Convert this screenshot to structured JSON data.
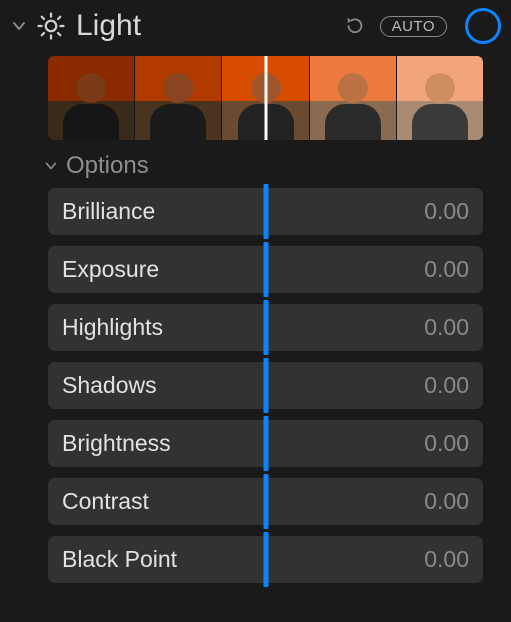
{
  "header": {
    "title": "Light",
    "auto_label": "AUTO"
  },
  "options": {
    "title": "Options"
  },
  "sliders": [
    {
      "label": "Brilliance",
      "value": "0.00",
      "position": 0.5
    },
    {
      "label": "Exposure",
      "value": "0.00",
      "position": 0.5
    },
    {
      "label": "Highlights",
      "value": "0.00",
      "position": 0.5
    },
    {
      "label": "Shadows",
      "value": "0.00",
      "position": 0.5
    },
    {
      "label": "Brightness",
      "value": "0.00",
      "position": 0.5
    },
    {
      "label": "Contrast",
      "value": "0.00",
      "position": 0.5
    },
    {
      "label": "Black Point",
      "value": "0.00",
      "position": 0.5
    }
  ],
  "preview": {
    "indicator_position": 0.5
  }
}
